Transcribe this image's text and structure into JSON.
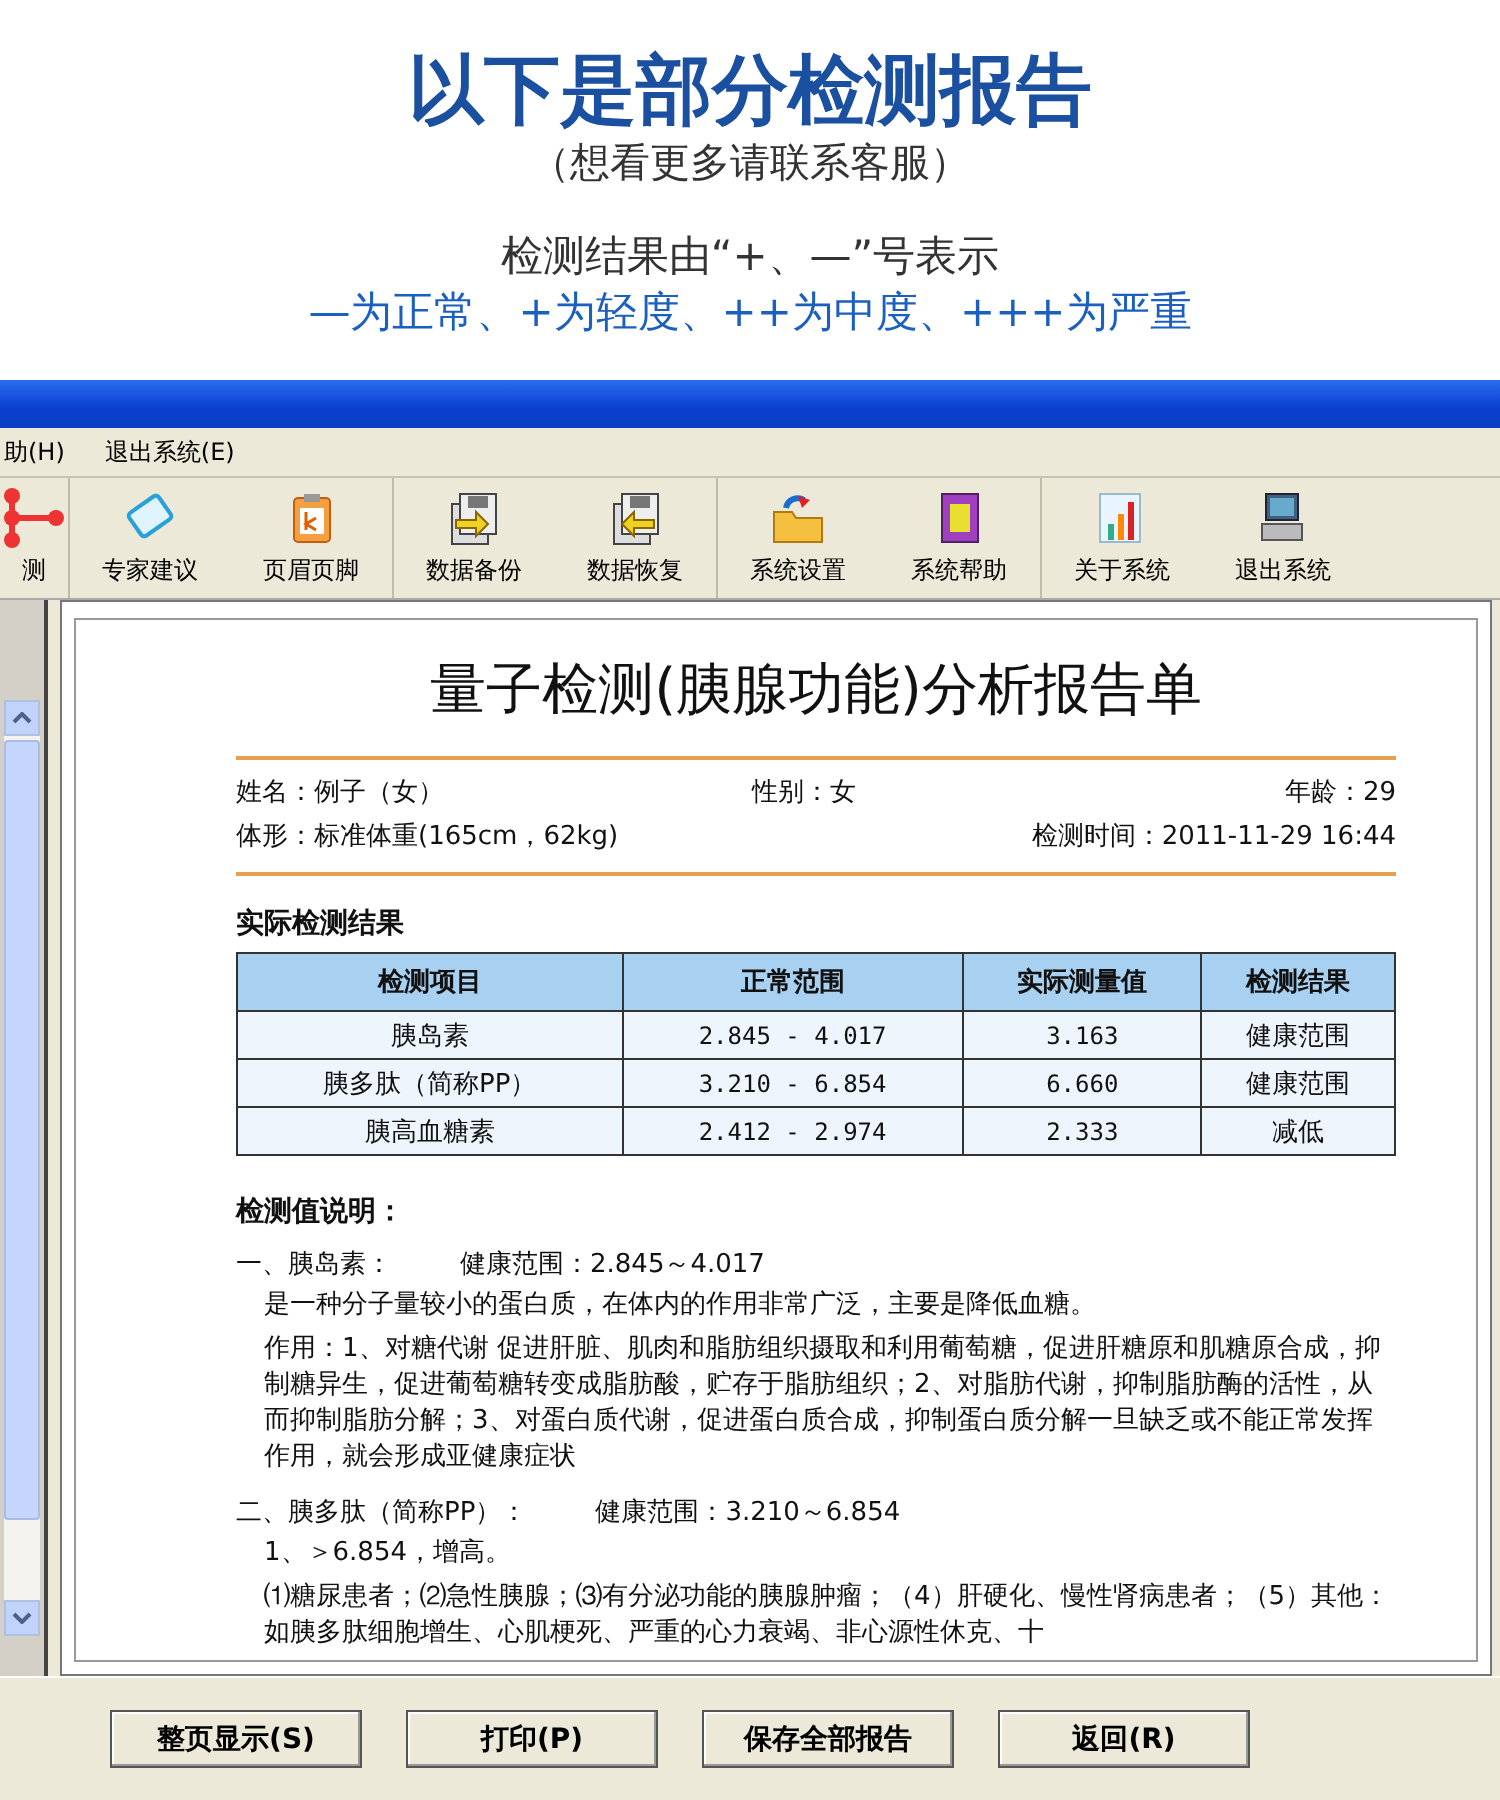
{
  "banner": {
    "title": "以下是部分检测报告",
    "subtitle": "（想看更多请联系客服）",
    "legend_title": "检测结果由“+、—”号表示",
    "legend": "—为正常、+为轻度、++为中度、+++为严重"
  },
  "menu": [
    "助(H)",
    "退出系统(E)"
  ],
  "toolbar": [
    {
      "label": "测"
    },
    {
      "label": "专家建议"
    },
    {
      "label": "页眉页脚"
    },
    {
      "label": "数据备份"
    },
    {
      "label": "数据恢复"
    },
    {
      "label": "系统设置"
    },
    {
      "label": "系统帮助"
    },
    {
      "label": "关于系统"
    },
    {
      "label": "退出系统"
    }
  ],
  "report": {
    "title": "量子检测(胰腺功能)分析报告单",
    "info_rows": [
      [
        {
          "label": "姓名：",
          "value": "例子（女）"
        },
        {
          "label": "性别：",
          "value": "女"
        },
        {
          "label": "年龄：",
          "value": "29"
        }
      ],
      [
        {
          "label": "体形：",
          "value": "标准体重(165cm，62kg)"
        },
        {
          "label": "检测时间：",
          "value": "2011-11-29 16:44"
        }
      ]
    ],
    "results_title": "实际检测结果",
    "table": {
      "columns": [
        "检测项目",
        "正常范围",
        "实际测量值",
        "检测结果"
      ],
      "rows": [
        [
          "胰岛素",
          "2.845 - 4.017",
          "3.163",
          "健康范围"
        ],
        [
          "胰多肽（简称PP）",
          "3.210 - 6.854",
          "6.660",
          "健康范围"
        ],
        [
          "胰高血糖素",
          "2.412 - 2.974",
          "2.333",
          "减低"
        ]
      ]
    },
    "explanation_title": "检测值说明：",
    "sections": [
      {
        "heading": "一、胰岛素：",
        "range": "健康范围：2.845～4.017",
        "paragraphs": [
          "是一种分子量较小的蛋白质，在体内的作用非常广泛，主要是降低血糖。",
          "作用：1、对糖代谢 促进肝脏、肌肉和脂肪组织摄取和利用葡萄糖，促进肝糖原和肌糖原合成，抑制糖异生，促进葡萄糖转变成脂肪酸，贮存于脂肪组织；2、对脂肪代谢，抑制脂肪酶的活性，从而抑制脂肪分解；3、对蛋白质代谢，促进蛋白质合成，抑制蛋白质分解一旦缺乏或不能正常发挥作用，就会形成亚健康症状"
        ]
      },
      {
        "heading": "二、胰多肽（简称PP）：",
        "range": "健康范围：3.210～6.854",
        "paragraphs": [
          "1、＞6.854，增高。",
          "⑴糖尿患者；⑵急性胰腺；⑶有分泌功能的胰腺肿瘤；（4）肝硬化、慢性肾病患者；（5）其他：如胰多肽细胞增生、心肌梗死、严重的心力衰竭、非心源性休克、十"
        ]
      }
    ]
  },
  "buttons": [
    "整页显示(S)",
    "打印(P)",
    "保存全部报告",
    "返回(R)"
  ]
}
